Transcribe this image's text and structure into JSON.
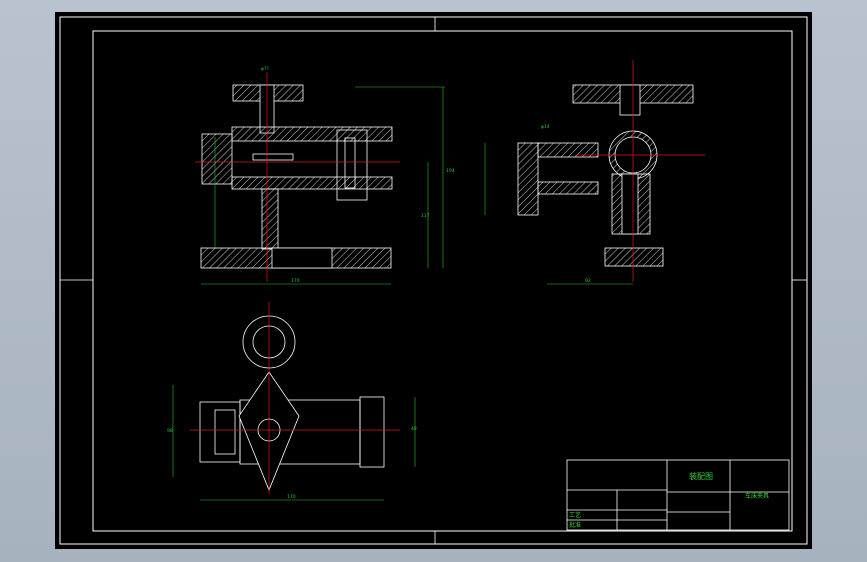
{
  "colors": {
    "background": "#000000",
    "outline": "#ffffff",
    "dimension": "#26c426",
    "centerline": "#e01818",
    "hatch": "#ffffff",
    "titleblock_text": "#34d034"
  },
  "title_block": {
    "drawing_name": "装配图",
    "part_name": "车床夹具",
    "labels": {
      "process": "工艺",
      "approve": "批准"
    }
  },
  "dimensions": {
    "front_top": "φ??",
    "front_right": "194",
    "front_right_2": "117",
    "front_bottom": "170",
    "side_bottom": "92",
    "side_diam": "φ14",
    "plan_width": "170",
    "plan_height": "98",
    "plan_right": "48"
  }
}
